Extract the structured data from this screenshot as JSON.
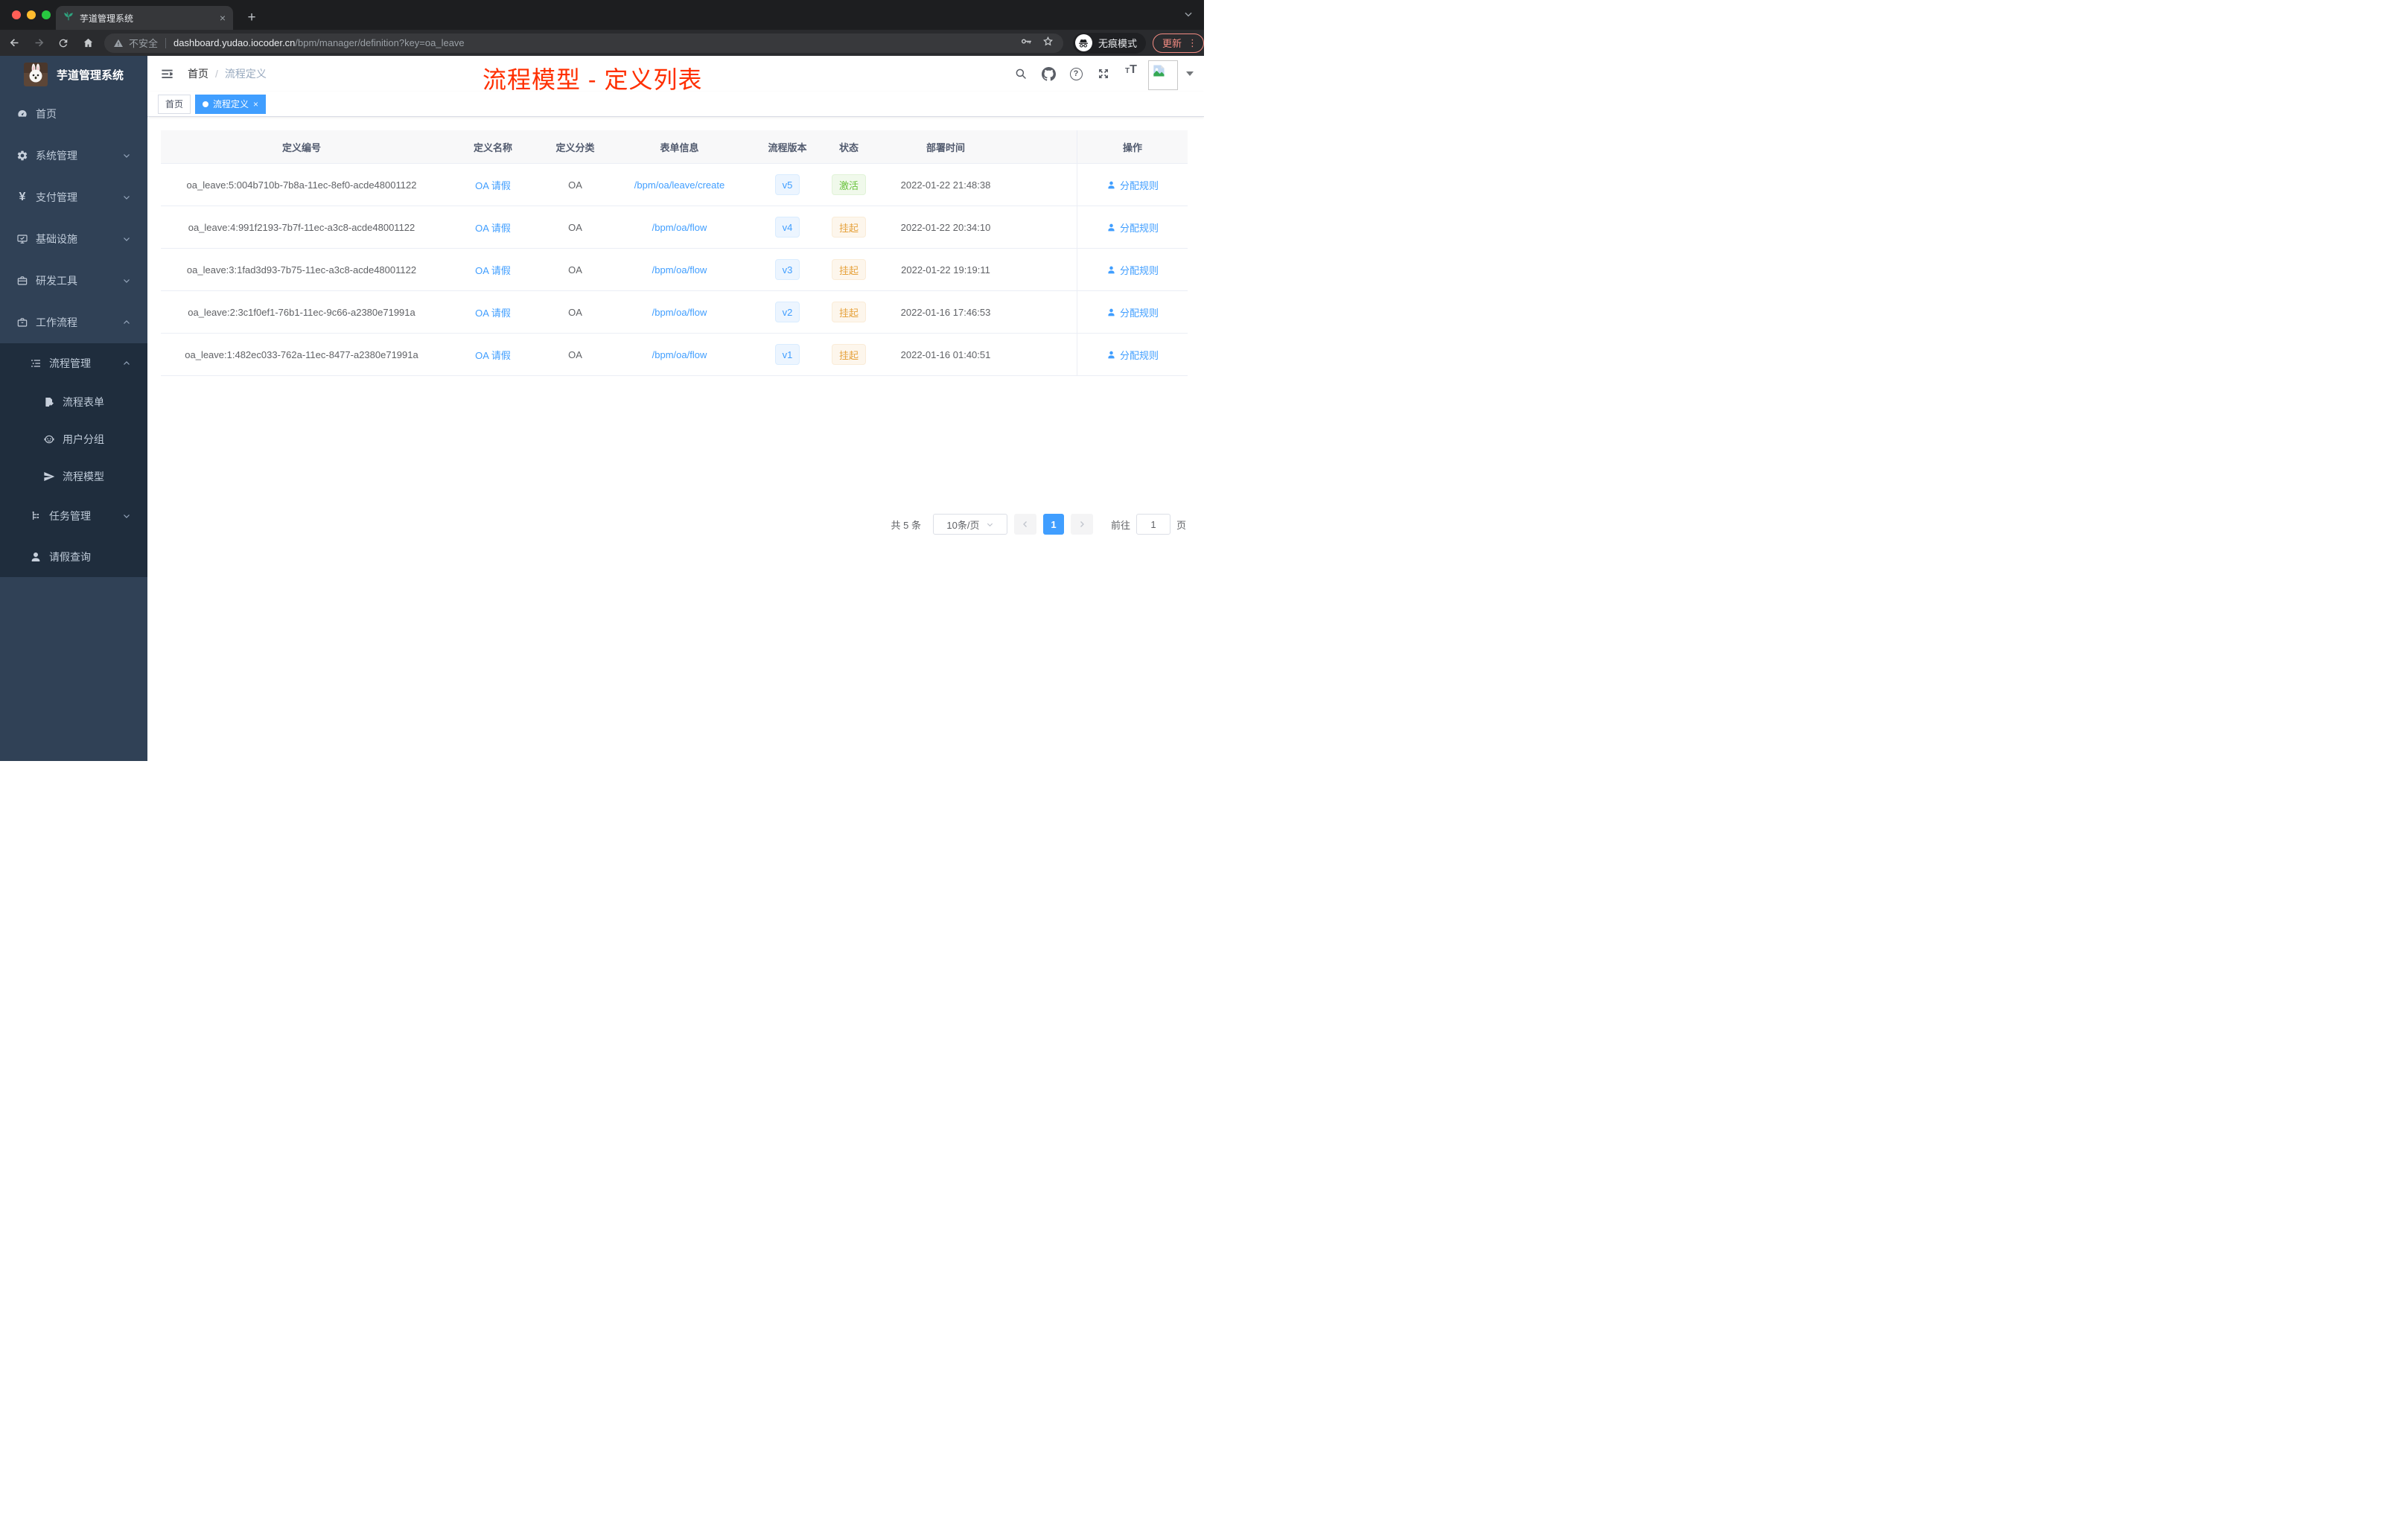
{
  "colors": {
    "accent": "#409eff",
    "success": "#67c23a",
    "warning": "#e6a23c",
    "annotation_red": "#ff2f00",
    "sidebar_bg": "#304156",
    "submenu_bg": "#1f2d3d"
  },
  "browser": {
    "tab_title": "芋道管理系统",
    "close_label": "×",
    "new_tab_label": "+",
    "security_label": "不安全",
    "url_domain": "dashboard.yudao.iocoder.cn",
    "url_path": "/bpm/manager/definition?key=oa_leave",
    "incognito_label": "无痕模式",
    "update_label": "更新",
    "menu_dots": "⋮"
  },
  "sidebar": {
    "title": "芋道管理系统",
    "menu": [
      {
        "label": "首页"
      },
      {
        "label": "系统管理"
      },
      {
        "label": "支付管理"
      },
      {
        "label": "基础设施"
      },
      {
        "label": "研发工具"
      },
      {
        "label": "工作流程"
      },
      {
        "label": "流程管理"
      },
      {
        "label": "流程表单"
      },
      {
        "label": "用户分组"
      },
      {
        "label": "流程模型"
      },
      {
        "label": "任务管理"
      },
      {
        "label": "请假查询"
      }
    ]
  },
  "navbar": {
    "breadcrumb_home": "首页",
    "breadcrumb_sep": "/",
    "breadcrumb_current": "流程定义"
  },
  "annotation": "流程模型 - 定义列表",
  "tags": {
    "home": "首页",
    "active": "流程定义",
    "active_close": "×"
  },
  "table": {
    "columns": [
      "定义编号",
      "定义名称",
      "定义分类",
      "表单信息",
      "流程版本",
      "状态",
      "部署时间",
      "操作"
    ],
    "rows": [
      {
        "id": "oa_leave:5:004b710b-7b8a-11ec-8ef0-acde48001122",
        "name": "OA 请假",
        "category": "OA",
        "form": "/bpm/oa/leave/create",
        "version": "v5",
        "status": "激活",
        "status_type": "success",
        "time": "2022-01-22 21:48:38",
        "action": "分配规则"
      },
      {
        "id": "oa_leave:4:991f2193-7b7f-11ec-a3c8-acde48001122",
        "name": "OA 请假",
        "category": "OA",
        "form": "/bpm/oa/flow",
        "version": "v4",
        "status": "挂起",
        "status_type": "warning",
        "time": "2022-01-22 20:34:10",
        "action": "分配规则"
      },
      {
        "id": "oa_leave:3:1fad3d93-7b75-11ec-a3c8-acde48001122",
        "name": "OA 请假",
        "category": "OA",
        "form": "/bpm/oa/flow",
        "version": "v3",
        "status": "挂起",
        "status_type": "warning",
        "time": "2022-01-22 19:19:11",
        "action": "分配规则"
      },
      {
        "id": "oa_leave:2:3c1f0ef1-76b1-11ec-9c66-a2380e71991a",
        "name": "OA 请假",
        "category": "OA",
        "form": "/bpm/oa/flow",
        "version": "v2",
        "status": "挂起",
        "status_type": "warning",
        "time": "2022-01-16 17:46:53",
        "action": "分配规则"
      },
      {
        "id": "oa_leave:1:482ec033-762a-11ec-8477-a2380e71991a",
        "name": "OA 请假",
        "category": "OA",
        "form": "/bpm/oa/flow",
        "version": "v1",
        "status": "挂起",
        "status_type": "warning",
        "time": "2022-01-16 01:40:51",
        "action": "分配规则"
      }
    ]
  },
  "pagination": {
    "total": "共 5 条",
    "page_size": "10条/页",
    "page": "1",
    "goto_label": "前往",
    "goto_value": "1",
    "unit_label": "页"
  }
}
